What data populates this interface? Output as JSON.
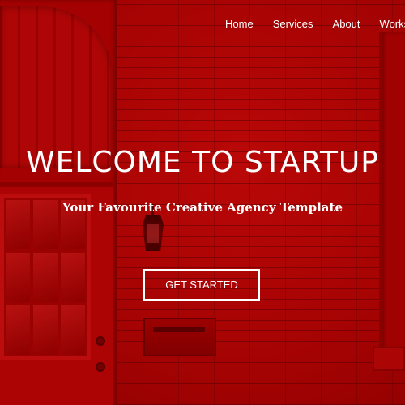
{
  "nav": {
    "items": [
      {
        "label": "Home"
      },
      {
        "label": "Services"
      },
      {
        "label": "About"
      },
      {
        "label": "Works"
      }
    ]
  },
  "hero": {
    "title": "WELCOME TO STARTUP",
    "subtitle": "Your Favourite Creative Agency Template",
    "cta_label": "GET STARTED"
  },
  "colors": {
    "background": "#b30000",
    "text": "#ffffff"
  }
}
